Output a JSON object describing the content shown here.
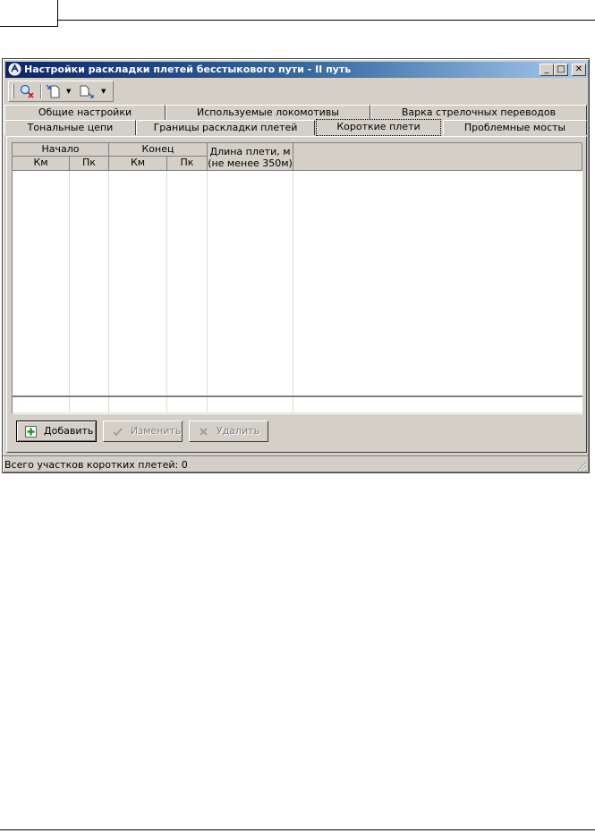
{
  "window": {
    "title": "Настройки раскладки плетей бесстыкового пути - II путь",
    "caption_buttons": {
      "minimize": "_",
      "maximize": "□",
      "close": "✕"
    }
  },
  "toolbar": {
    "icons": [
      "search-delete-icon",
      "new-document-icon",
      "export-document-icon"
    ],
    "dropdown_caret": "▼"
  },
  "tabs": {
    "row1": [
      {
        "label": "Общие настройки"
      },
      {
        "label": "Используемые локомотивы"
      },
      {
        "label": "Варка стрелочных переводов"
      }
    ],
    "row2": [
      {
        "label": "Тональные цепи"
      },
      {
        "label": "Границы раскладки плетей"
      },
      {
        "label": "Короткие плети",
        "active": true
      },
      {
        "label": "Проблемные мосты"
      }
    ]
  },
  "table": {
    "group_start": "Начало",
    "group_end": "Конец",
    "columns": {
      "start_km": "Км",
      "start_pk": "Пк",
      "end_km": "Км",
      "end_pk": "Пк",
      "length_line1": "Длина плети, м",
      "length_line2": "(не менее 350м)"
    },
    "rows": []
  },
  "buttons": {
    "add": "Добавить",
    "edit": "Изменить",
    "delete": "Удалить"
  },
  "status": {
    "text": "Всего участков коротких плетей: 0"
  }
}
